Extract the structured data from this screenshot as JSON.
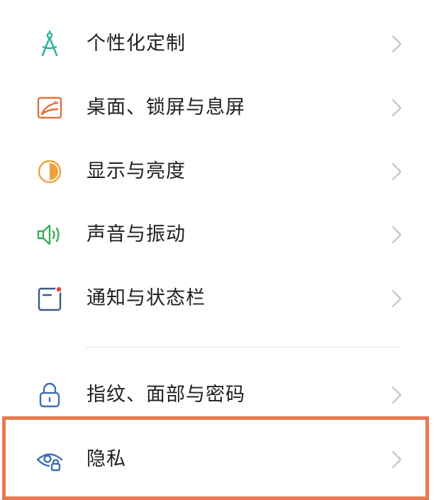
{
  "settings": {
    "items": [
      {
        "label": "个性化定制",
        "icon": "compass-icon",
        "color": "#2bb19c"
      },
      {
        "label": "桌面、锁屏与息屏",
        "icon": "wallpaper-icon",
        "color": "#e2703a"
      },
      {
        "label": "显示与亮度",
        "icon": "brightness-icon",
        "color": "#f0a03c"
      },
      {
        "label": "声音与振动",
        "icon": "speaker-icon",
        "color": "#3aae5a"
      },
      {
        "label": "通知与状态栏",
        "icon": "notification-icon",
        "color": "#3a5a8a"
      },
      {
        "label": "指纹、面部与密码",
        "icon": "lock-icon",
        "color": "#3d6db5"
      },
      {
        "label": "隐私",
        "icon": "privacy-eye-icon",
        "color": "#3d6db5"
      }
    ],
    "highlight_color": "#e87a4f",
    "chevron_color": "#c4c4c4"
  }
}
